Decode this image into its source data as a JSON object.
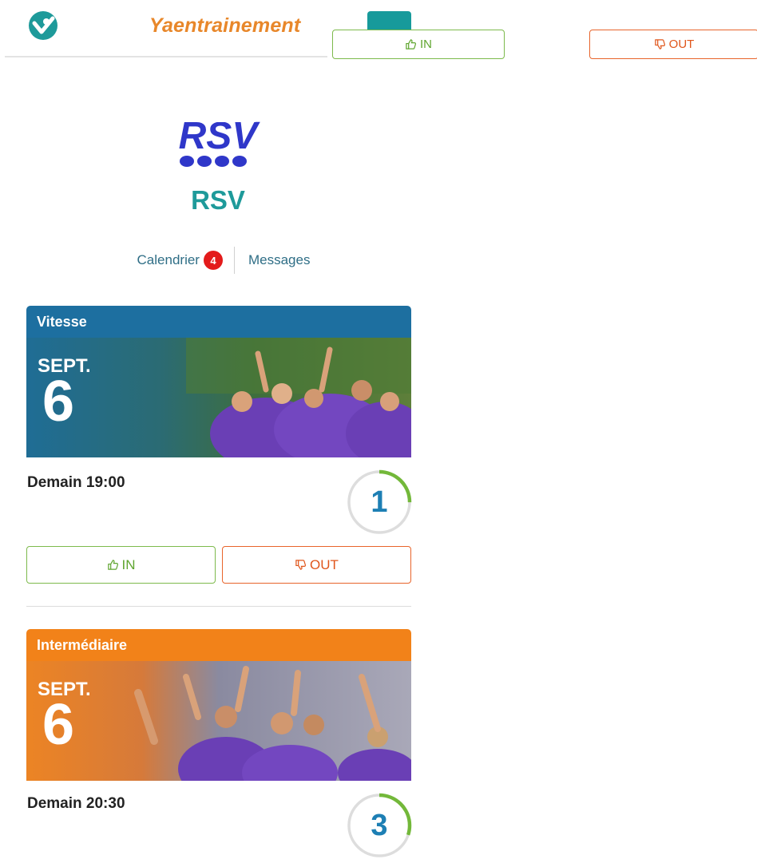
{
  "header": {
    "brand": "Yaentrainement",
    "logo_icon": "check-heart-logo",
    "menu_icon": "menu-icon"
  },
  "top_actions": {
    "in_label": "IN",
    "out_label": "OUT"
  },
  "team": {
    "logo_text": "RSV",
    "name": "RSV"
  },
  "tabs": {
    "calendar_label": "Calendrier",
    "calendar_count": "4",
    "messages_label": "Messages"
  },
  "events": [
    {
      "category": "Vitesse",
      "month": "SEPT.",
      "day": "6",
      "time": "Demain 19:00",
      "participants": "1",
      "participants_fraction": 0.25,
      "in_label": "IN",
      "out_label": "OUT",
      "color": "#1d6fa0"
    },
    {
      "category": "Intermédiaire",
      "month": "SEPT.",
      "day": "6",
      "time": "Demain 20:30",
      "participants": "3",
      "participants_fraction": 0.3,
      "color": "#f28219"
    }
  ],
  "colors": {
    "accent": "#1e9a9a",
    "in": "#5fa52f",
    "out": "#e0561b",
    "brand_orange": "#e8872a"
  }
}
